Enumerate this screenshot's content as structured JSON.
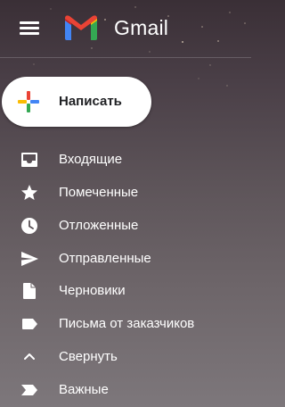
{
  "header": {
    "title": "Gmail",
    "menu_icon": "hamburger-menu-icon",
    "logo_icon": "gmail-logo-icon"
  },
  "compose": {
    "label": "Написать",
    "icon": "compose-plus-icon"
  },
  "nav": {
    "items": [
      {
        "label": "Входящие",
        "icon": "inbox-icon"
      },
      {
        "label": "Помеченные",
        "icon": "star-icon"
      },
      {
        "label": "Отложенные",
        "icon": "clock-icon"
      },
      {
        "label": "Отправленные",
        "icon": "send-icon"
      },
      {
        "label": "Черновики",
        "icon": "draft-icon"
      },
      {
        "label": "Письма от заказчиков",
        "icon": "label-icon"
      },
      {
        "label": "Свернуть",
        "icon": "chevron-up-icon"
      },
      {
        "label": "Важные",
        "icon": "important-icon"
      }
    ]
  },
  "colors": {
    "text": "#ffffff",
    "compose_bg": "#ffffff",
    "compose_text": "#202124",
    "logo_red": "#EA4335",
    "logo_blue": "#4285F4",
    "logo_green": "#34A853",
    "logo_yellow": "#FBBC04"
  }
}
